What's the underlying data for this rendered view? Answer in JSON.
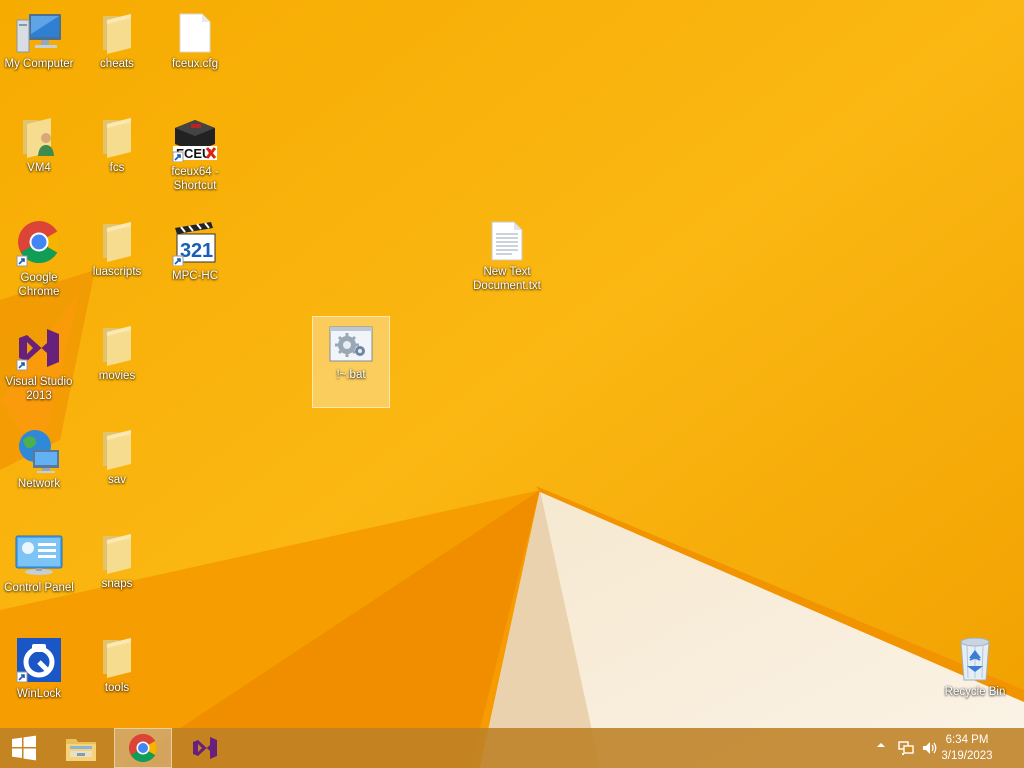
{
  "desktop": {
    "icons": [
      {
        "label": "My Computer",
        "icon": "computer-icon"
      },
      {
        "label": "cheats",
        "icon": "folder-icon"
      },
      {
        "label": "fceux.cfg",
        "icon": "file-icon"
      },
      {
        "label": "VM4",
        "icon": "user-folder-icon"
      },
      {
        "label": "fcs",
        "icon": "folder-icon"
      },
      {
        "label": "fceux64 - Shortcut",
        "icon": "fceux-icon"
      },
      {
        "label": "Google Chrome",
        "icon": "chrome-icon"
      },
      {
        "label": "luascripts",
        "icon": "folder-icon"
      },
      {
        "label": "MPC-HC",
        "icon": "mpc-hc-icon"
      },
      {
        "label": "New Text Document.txt",
        "icon": "text-document-icon"
      },
      {
        "label": "!~.bat",
        "icon": "batch-file-icon",
        "selected": true
      },
      {
        "label": "Visual Studio 2013",
        "icon": "visual-studio-icon"
      },
      {
        "label": "movies",
        "icon": "folder-icon"
      },
      {
        "label": "Network",
        "icon": "network-icon"
      },
      {
        "label": "sav",
        "icon": "folder-icon"
      },
      {
        "label": "Control Panel",
        "icon": "control-panel-icon"
      },
      {
        "label": "snaps",
        "icon": "folder-icon"
      },
      {
        "label": "WinLock",
        "icon": "winlock-icon"
      },
      {
        "label": "tools",
        "icon": "folder-icon"
      },
      {
        "label": "Recycle Bin",
        "icon": "recycle-bin-icon"
      }
    ]
  },
  "taskbar": {
    "start_icon": "windows-logo-icon",
    "pinned": [
      {
        "icon": "file-explorer-icon"
      },
      {
        "icon": "chrome-icon",
        "active": true
      },
      {
        "icon": "visual-studio-icon"
      }
    ],
    "tray": {
      "icons": [
        "show-hidden-icons-icon",
        "network-icon",
        "volume-icon"
      ],
      "time": "6:34 PM",
      "date": "3/19/2023"
    }
  },
  "colors": {
    "wallpaper": "#F7A600",
    "taskbar": "#BD8126"
  }
}
